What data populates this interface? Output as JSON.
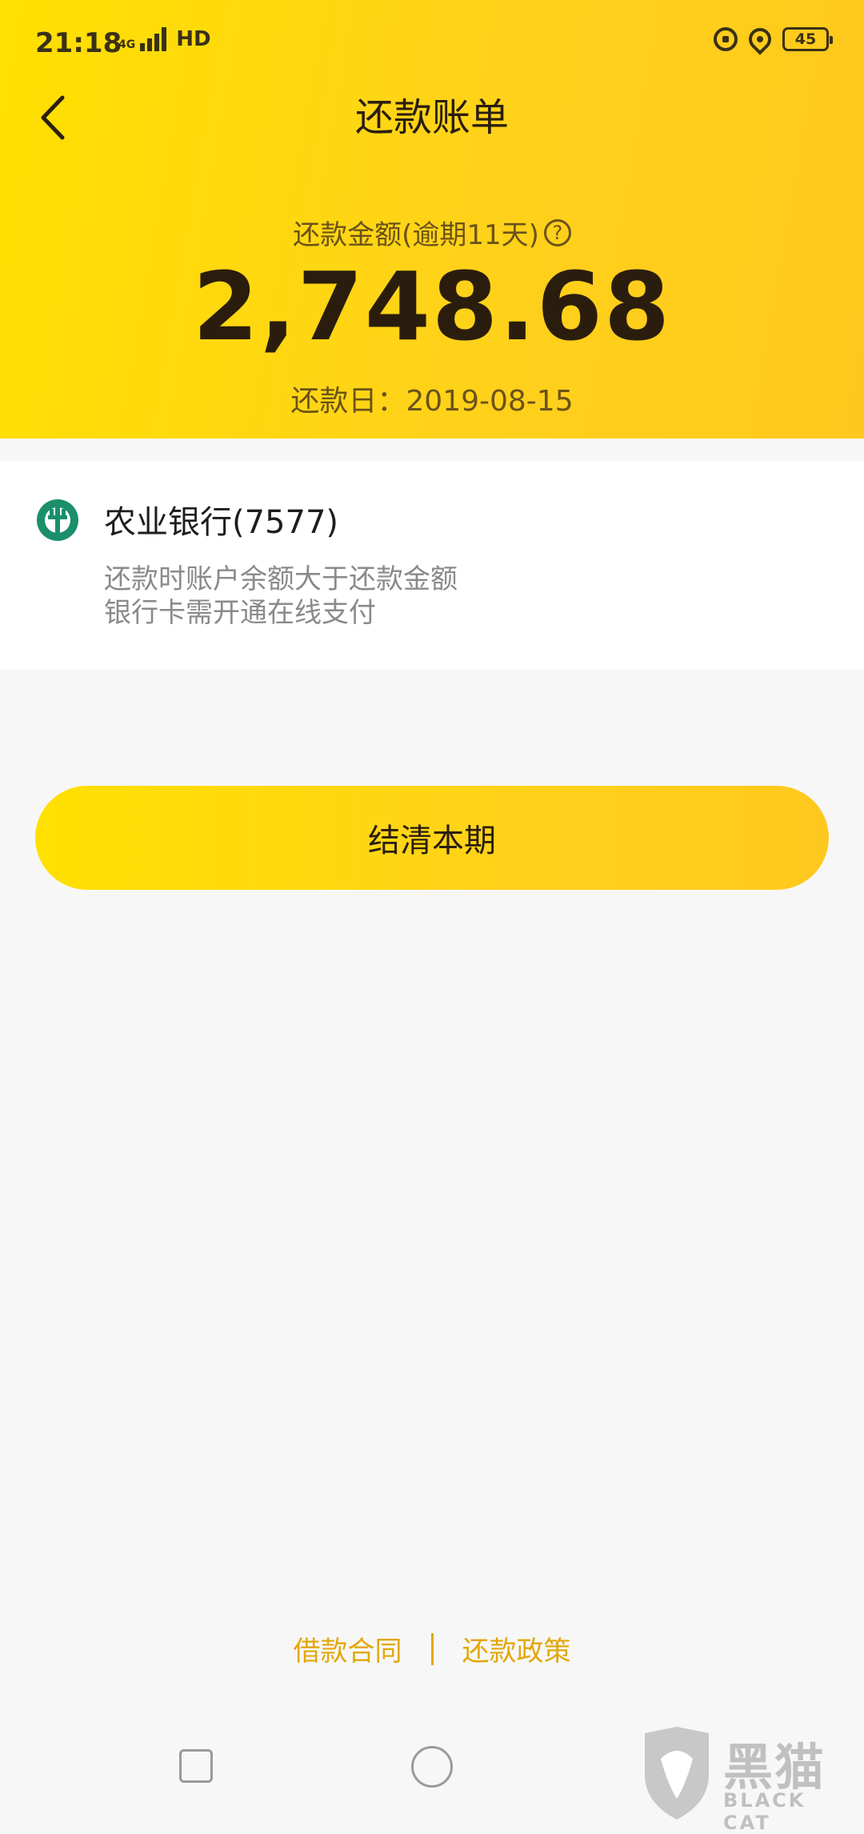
{
  "status_bar": {
    "time": "21:18",
    "network": "4G",
    "hd": "HD",
    "battery": "45",
    "icons": [
      "signal-icon",
      "lock-rotate-icon",
      "location-icon",
      "battery-icon"
    ]
  },
  "header": {
    "title": "还款账单",
    "amount_label": "还款金额(逾期11天)",
    "amount": "2,748.68",
    "due_label": "还款日：",
    "due_date": "2019-08-15"
  },
  "bank": {
    "name": "农业银行(7577)",
    "notes": [
      "还款时账户余额大于还款金额",
      "银行卡需开通在线支付"
    ],
    "icon": "abc-bank-logo-icon"
  },
  "actions": {
    "settle_label": "结清本期"
  },
  "footer": {
    "links": [
      "借款合同",
      "还款政策"
    ]
  },
  "watermark": {
    "cn": "黑猫",
    "en": "BLACK CAT"
  },
  "colors": {
    "header_yellow": "#ffd21a",
    "link_orange": "#e2a70a",
    "bank_green": "#1b8f6b",
    "text_dark": "#2b1e0f"
  }
}
